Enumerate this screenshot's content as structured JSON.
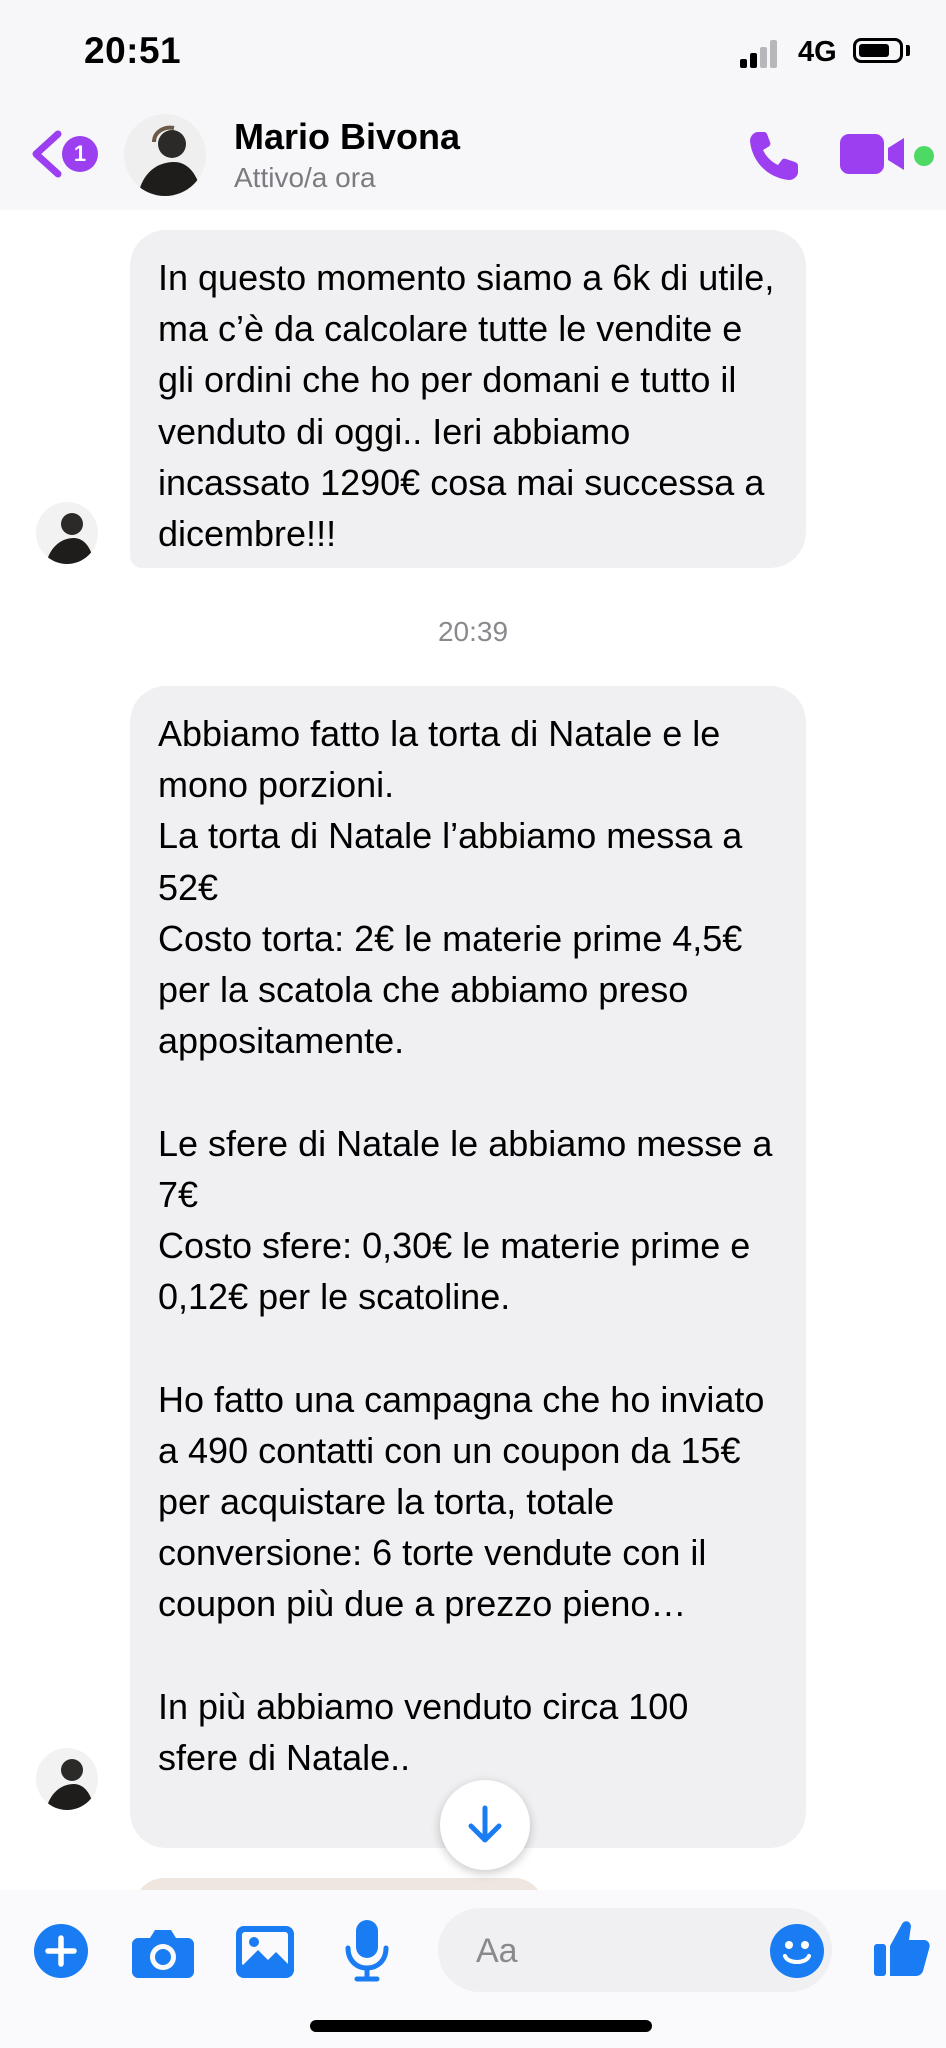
{
  "status_bar": {
    "time": "20:51",
    "network": "4G",
    "signal_bars_filled": 2,
    "signal_bars_total": 4,
    "battery_level": 0.8
  },
  "header": {
    "back_badge_count": "1",
    "contact_name": "Mario Bivona",
    "contact_status": "Attivo/a ora",
    "accent_color": "#9b3ff0",
    "online_color": "#4cd964",
    "icons": [
      "chevron-left-icon",
      "phone-icon",
      "video-camera-icon"
    ]
  },
  "messages": [
    {
      "sender": "Mario Bivona",
      "text": "In questo momento siamo a 6k di utile, ma c’è da calcolare tutte le vendite e gli ordini che ho per domani e tutto il venduto di oggi.. Ieri abbiamo incassato 1290€ cosa mai successa a dicembre!!!"
    },
    {
      "timestamp": "20:39"
    },
    {
      "sender": "Mario Bivona",
      "text": "Abbiamo fatto la torta di Natale e le mono porzioni.\nLa torta di Natale l’abbiamo messa a 52€\nCosto torta: 2€ le materie prime 4,5€ per la scatola che abbiamo preso appositamente.\n\nLe sfere di Natale le abbiamo messe a 7€\nCosto sfere: 0,30€ le materie prime e 0,12€ per le scatoline.\n\nHo fatto una campagna che ho inviato a 490 contatti con un coupon da 15€ per acquistare la torta, totale conversione: 6 torte vendute con il coupon più due a prezzo pieno…\n\nIn più abbiamo venduto circa 100 sfere di Natale.."
    }
  ],
  "composer": {
    "placeholder": "Aa",
    "value": "",
    "icon_color": "#1a7cf2",
    "icons": [
      "plus-icon",
      "camera-icon",
      "image-icon",
      "microphone-icon",
      "emoji-icon",
      "thumbs-up-icon"
    ]
  }
}
